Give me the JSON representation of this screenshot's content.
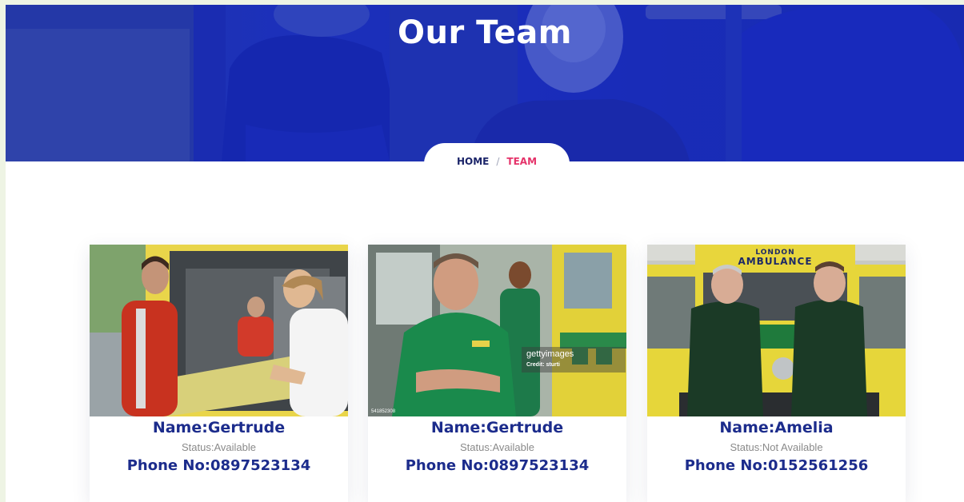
{
  "hero": {
    "title": "Our Team"
  },
  "breadcrumb": {
    "home": "HOME",
    "separator": "/",
    "current": "TEAM"
  },
  "team": [
    {
      "name": "Name:Gertrude",
      "status": "Status:Available",
      "phone": "Phone No:0897523134"
    },
    {
      "name": "Name:Gertrude",
      "status": "Status:Available",
      "phone": "Phone No:0897523134",
      "watermark": "gettyimages",
      "watermark_credit": "Credit: sturti",
      "photo_id": "541852308"
    },
    {
      "name": "Name:Amelia",
      "status": "Status:Not Available",
      "phone": "Phone No:0152561256",
      "vehicle_sign_top": "LONDON",
      "vehicle_sign": "AMBULANCE"
    }
  ],
  "colors": {
    "hero_blue": "#1f34b6",
    "name_blue": "#1c2c8c",
    "breadcrumb_active": "#e5336a",
    "breadcrumb_home": "#1b2469"
  }
}
